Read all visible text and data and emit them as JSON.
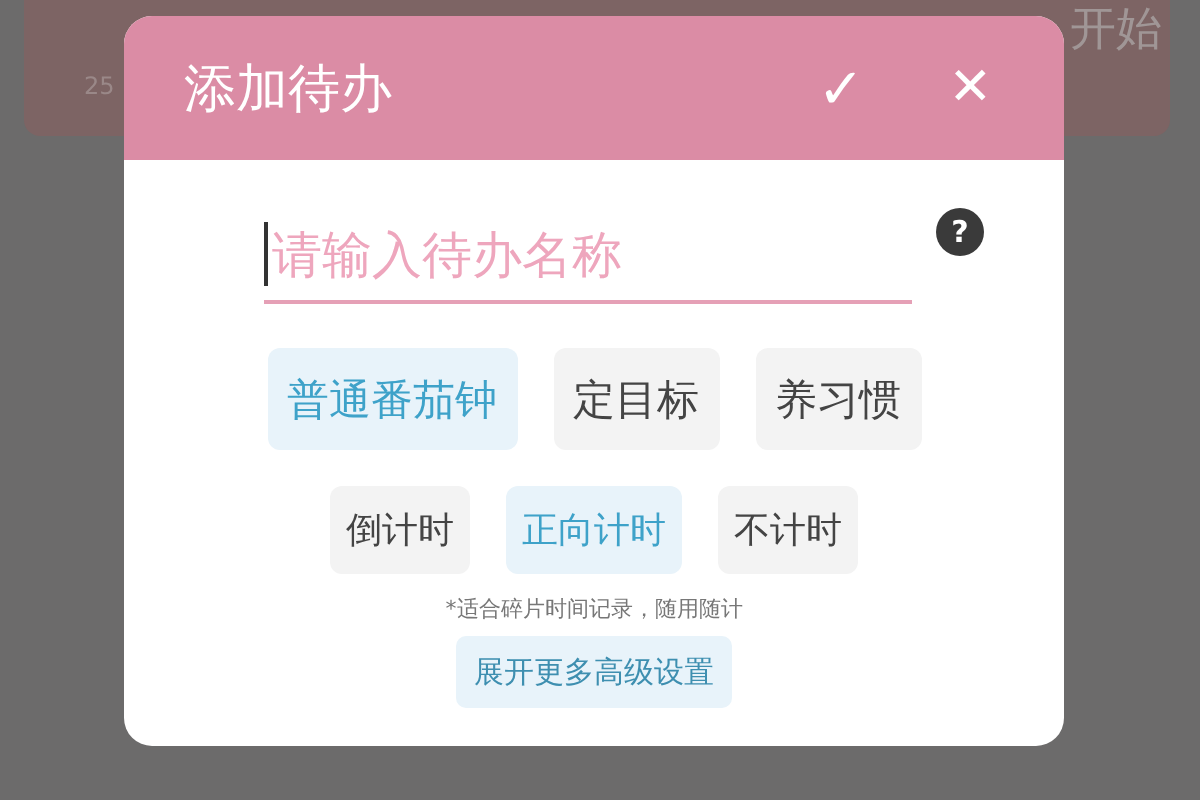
{
  "background_card": {
    "count": "25",
    "start_label": "开始"
  },
  "dialog": {
    "title": "添加待办",
    "confirm_icon": "✓",
    "close_icon": "✕",
    "name_field": {
      "placeholder": "请输入待办名称"
    },
    "help_icon": "?",
    "modes": [
      {
        "label": "普通番茄钟",
        "selected": true
      },
      {
        "label": "定目标",
        "selected": false
      },
      {
        "label": "养习惯",
        "selected": false
      }
    ],
    "timers": [
      {
        "label": "倒计时",
        "selected": false
      },
      {
        "label": "正向计时",
        "selected": true
      },
      {
        "label": "不计时",
        "selected": false
      }
    ],
    "hint": "*适合碎片时间记录，随用随计",
    "expand_button": "展开更多高级设置"
  }
}
